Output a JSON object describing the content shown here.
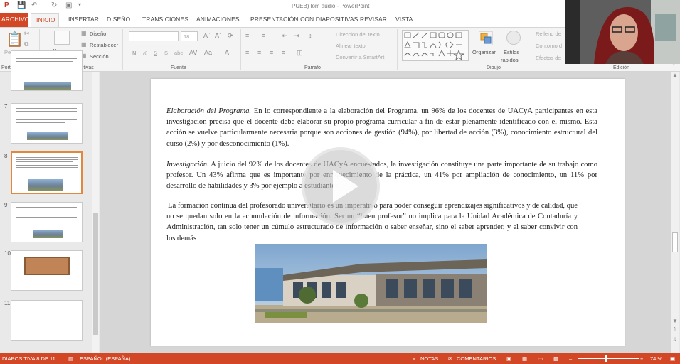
{
  "window": {
    "title": "PUEB) lom audio - PowerPoint"
  },
  "tabs": [
    "ARCHIVO",
    "INICIO",
    "INSERTAR",
    "DISEÑO",
    "TRANSICIONES",
    "ANIMACIONES",
    "PRESENTACIÓN CON DIAPOSITIVAS",
    "REVISAR",
    "VISTA"
  ],
  "ribbon": {
    "clipboard": {
      "paste": "Pegar",
      "label": "Portapapeles"
    },
    "slides": {
      "new_slide_line1": "Nueva",
      "new_slide_line2": "diapositiva",
      "layout": "Diseño",
      "reset": "Restablecer",
      "section": "Sección",
      "label": "Diapositivas"
    },
    "font": {
      "size": "18",
      "bold": "N",
      "italic": "K",
      "underline": "S",
      "shadow": "S",
      "strike": "abc",
      "label": "Fuente"
    },
    "paragraph": {
      "direction": "Dirección del texto",
      "align": "Alinear texto",
      "smartart": "Convertir a SmartArt",
      "label": "Párrafo"
    },
    "drawing": {
      "arrange": "Organizar",
      "quick_styles_line1": "Estilos",
      "quick_styles_line2": "rápidos",
      "fill": "Relleno de",
      "outline": "Contorno d",
      "effects": "Efectos de",
      "label": "Dibujo"
    },
    "editing": {
      "label": "Edición"
    }
  },
  "thumbnails": [
    {
      "num": "7"
    },
    {
      "num": "8",
      "selected": true
    },
    {
      "num": "9"
    },
    {
      "num": "10"
    },
    {
      "num": "11"
    }
  ],
  "slide": {
    "p1_title": "Elaboración del Programa.",
    "p1_body": " En lo correspondiente a la elaboración del Programa, un 96% de los docentes de UACyA participantes en esta investigación precisa que el docente debe elaborar su propio programa curricular a fin de estar plenamente identificado con el mismo. Esta acción se vuelve particularmente necesaria porque son acciones de gestión (94%), por libertad de acción (3%), conocimiento estructural del curso (2%) y por desconocimiento (1%).",
    "p2_title": "Investigación.",
    "p2_body": " A juicio del 92% de los docentes de UACyA encuestados, la investigación constituye una parte importante de su trabajo como profesor. Un 43% afirma que es importante por enriquecimiento de la práctica, un 41% por ampliación de conocimiento, un 11% por desarrollo de habilidades y 3% por ejemplo a estudiantes.",
    "p3": "La formación continua del profesorado universitario es un imperativo para poder conseguir aprendizajes significativos y de calidad, que no se quedan solo en la acumulación de información. Ser un “buen profesor” no implica para la Unidad Académica de Contaduría y Administración, tan solo tener un cúmulo estructurado de información o saber enseñar, sino el saber aprender, y el saber convivir con los demás"
  },
  "status": {
    "slide_pos": "DIAPOSITIVA 8 DE 11",
    "language": "ESPAÑOL (ESPAÑA)",
    "notes": "NOTAS",
    "comments": "COMENTARIOS",
    "zoom": "74 %"
  },
  "colors": {
    "accent": "#d24726",
    "ribbon_bg": "#f4f4f4",
    "thumb_select": "#e1873e"
  }
}
